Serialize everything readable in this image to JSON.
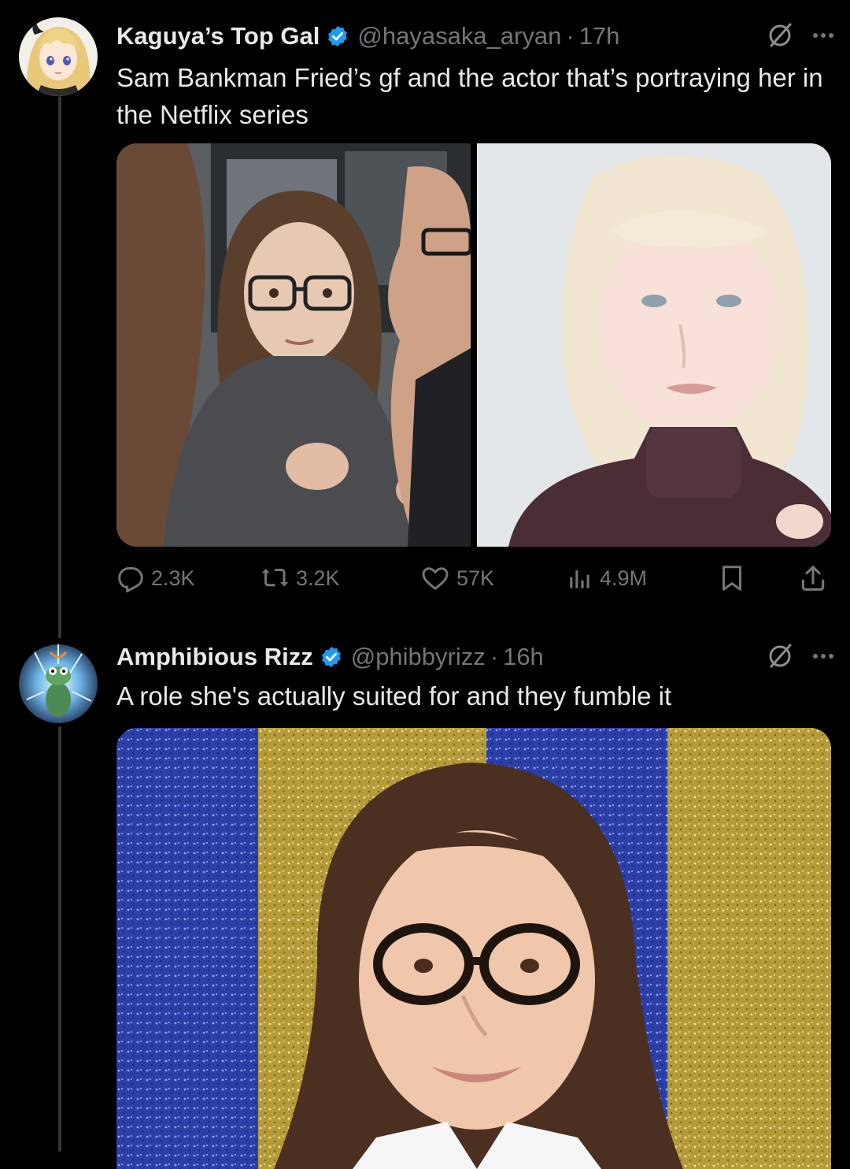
{
  "tweets": [
    {
      "display_name": "Kaguya’s Top Gal",
      "handle": "@hayasaka_aryan",
      "separator": "·",
      "time": "17h",
      "text": "Sam Bankman Fried’s gf and the actor that’s portraying her in the Netflix series",
      "avatar_icon": "anime-girl-avatar",
      "media": [
        {
          "icon": "photo-woman-glasses-crowd"
        },
        {
          "icon": "photo-blonde-woman-turtleneck"
        }
      ],
      "stats": {
        "replies": "2.3K",
        "reposts": "3.2K",
        "likes": "57K",
        "views": "4.9M"
      }
    },
    {
      "display_name": "Amphibious Rizz",
      "handle": "@phibbyrizz",
      "separator": "·",
      "time": "16h",
      "text": "A role she's actually suited for and they fumble it",
      "avatar_icon": "glowing-frog-avatar",
      "media": [
        {
          "icon": "photo-woman-glasses-glitter-backdrop"
        }
      ]
    }
  ],
  "colors": {
    "background": "#000000",
    "text_primary": "#e7e9ea",
    "text_secondary": "#71767b",
    "verified_blue": "#1d9bf0",
    "thread_line": "#333639"
  }
}
